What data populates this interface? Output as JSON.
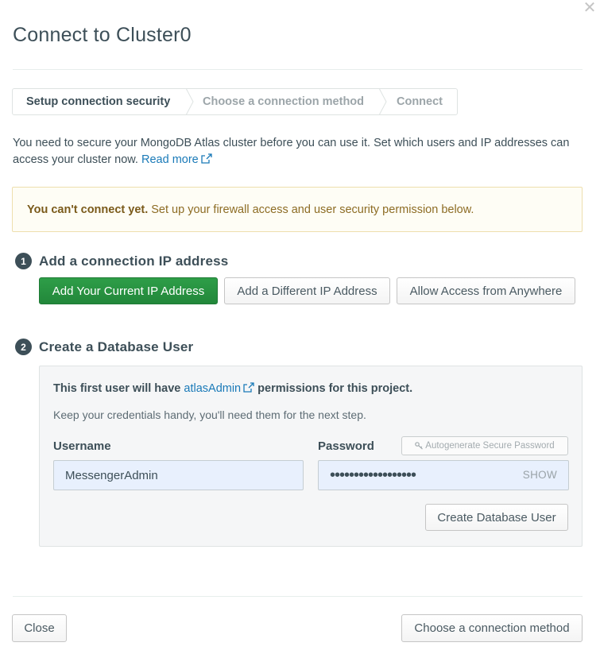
{
  "modal": {
    "title": "Connect to Cluster0",
    "close_icon": "close-icon"
  },
  "steps": [
    {
      "label": "Setup connection security",
      "active": true
    },
    {
      "label": "Choose a connection method",
      "active": false
    },
    {
      "label": "Connect",
      "active": false
    }
  ],
  "intro": {
    "text": "You need to secure your MongoDB Atlas cluster before you can use it. Set which users and IP addresses can access your cluster now.",
    "read_more": "Read more"
  },
  "alert": {
    "bold": "You can't connect yet.",
    "text": "Set up your firewall access and user security permission below."
  },
  "section1": {
    "number": "1",
    "title": "Add a connection IP address",
    "buttons": {
      "current_ip": "Add Your Current IP Address",
      "different_ip": "Add a Different IP Address",
      "anywhere": "Allow Access from Anywhere"
    }
  },
  "section2": {
    "number": "2",
    "title": "Create a Database User",
    "info_prefix": "This first user will have",
    "info_link": "atlasAdmin",
    "info_suffix": "permissions for this project.",
    "subtext": "Keep your credentials handy, you'll need them for the next step.",
    "username_label": "Username",
    "username_value": "MessengerAdmin",
    "password_label": "Password",
    "password_value": "••••••••••••••••••",
    "show_label": "SHOW",
    "autogenerate_label": "Autogenerate Secure Password",
    "create_user_button": "Create Database User"
  },
  "footer": {
    "close_button": "Close",
    "next_button": "Choose a connection method"
  },
  "colors": {
    "primary_green": "#22873a",
    "link_blue": "#1a7ab8",
    "alert_bg": "#fefdf5",
    "alert_text": "#8d6c24",
    "text_dark": "#3d4f58"
  }
}
